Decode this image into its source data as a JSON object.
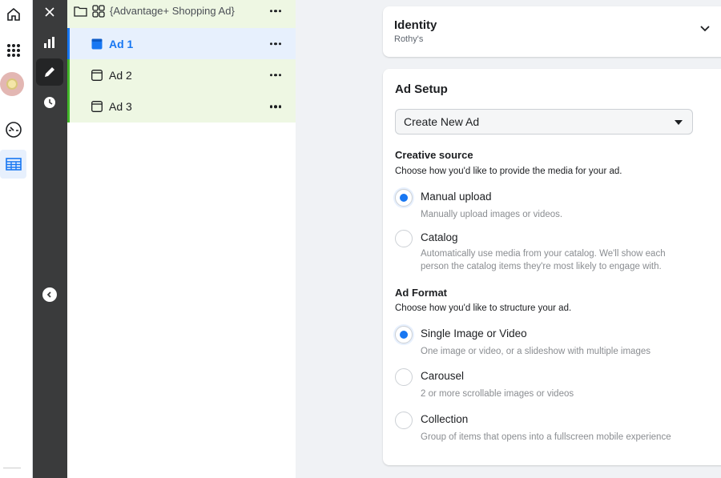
{
  "leftnav": {
    "items": [
      {
        "icon": "home-icon"
      },
      {
        "icon": "apps-grid-icon"
      },
      {
        "icon": "account-avatar"
      },
      {
        "icon": "dashboard-gauge-icon"
      },
      {
        "icon": "table-icon"
      }
    ]
  },
  "rail": {
    "items": [
      {
        "icon": "close-icon"
      },
      {
        "icon": "bar-chart-icon"
      },
      {
        "icon": "pencil-icon"
      },
      {
        "icon": "clock-icon"
      },
      {
        "icon": "collapse-left-icon"
      }
    ]
  },
  "tree": {
    "adset": {
      "label": "{Advantage+ Shopping Ad}"
    },
    "ads": [
      {
        "label": "Ad 1",
        "selected": true
      },
      {
        "label": "Ad 2",
        "selected": false
      },
      {
        "label": "Ad 3",
        "selected": false
      }
    ]
  },
  "identity": {
    "title": "Identity",
    "page": "Rothy's"
  },
  "ad_setup": {
    "title": "Ad Setup",
    "select_value": "Create New Ad",
    "creative_source": {
      "title": "Creative source",
      "description": "Choose how you'd like to provide the media for your ad.",
      "options": [
        {
          "label": "Manual upload",
          "description": "Manually upload images or videos.",
          "checked": true
        },
        {
          "label": "Catalog",
          "description": "Automatically use media from your catalog. We'll show each person the catalog items they're most likely to engage with.",
          "checked": false
        }
      ]
    },
    "ad_format": {
      "title": "Ad Format",
      "description": "Choose how you'd like to structure your ad.",
      "options": [
        {
          "label": "Single Image or Video",
          "description": "One image or video, or a slideshow with multiple images",
          "checked": true
        },
        {
          "label": "Carousel",
          "description": "2 or more scrollable images or videos",
          "checked": false
        },
        {
          "label": "Collection",
          "description": "Group of items that opens into a fullscreen mobile experience",
          "checked": false
        }
      ]
    }
  },
  "colors": {
    "accent": "#1877f2",
    "rail_bg": "#3a3b3c",
    "tree_row_bg": "#eef7e3",
    "selected_bg": "#e7f0fd"
  }
}
